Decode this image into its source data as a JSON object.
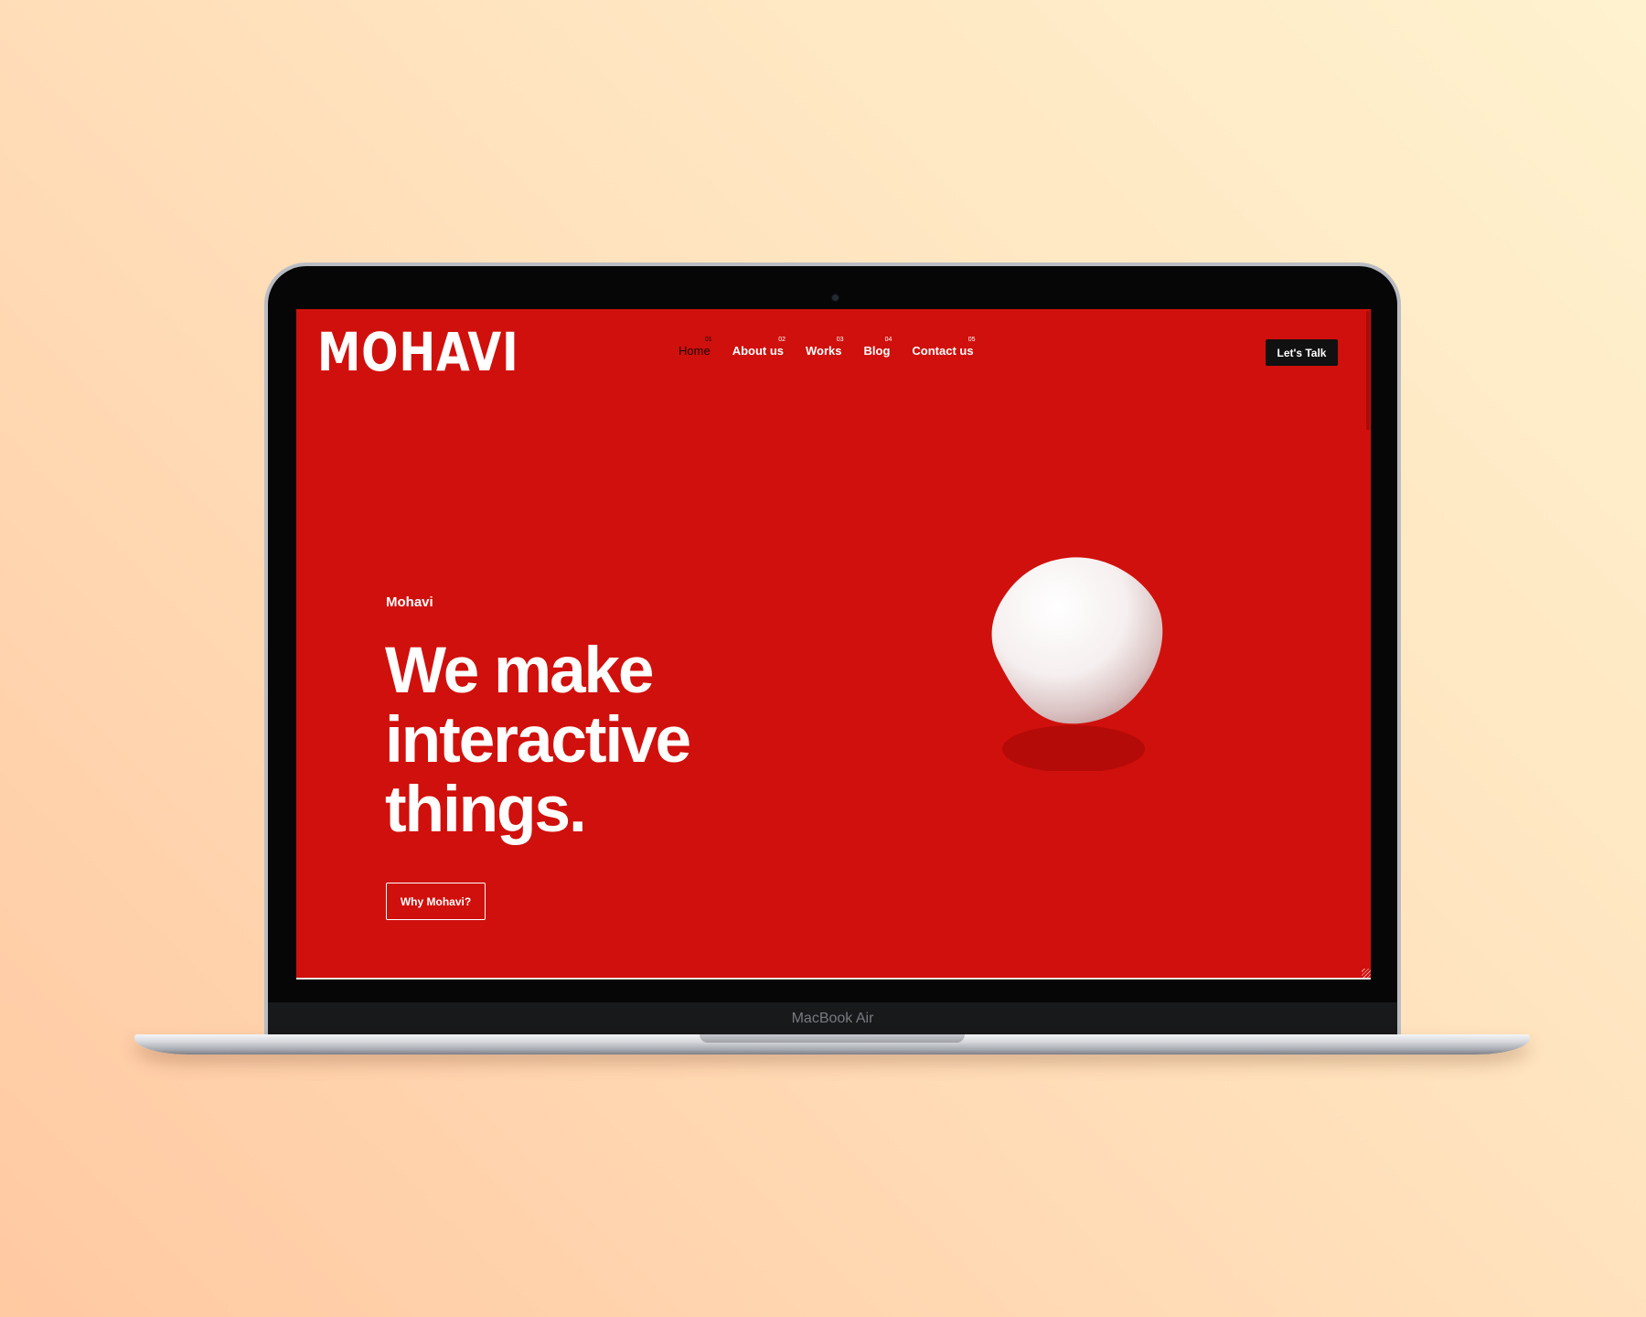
{
  "device": {
    "model_label": "MacBook Air"
  },
  "site": {
    "logo_text": "MOHAVI",
    "nav": [
      {
        "num": "01",
        "label": "Home",
        "active": true
      },
      {
        "num": "02",
        "label": "About us"
      },
      {
        "num": "03",
        "label": "Works"
      },
      {
        "num": "04",
        "label": "Blog"
      },
      {
        "num": "05",
        "label": "Contact us"
      }
    ],
    "cta_top_label": "Let's Talk",
    "hero": {
      "eyebrow": "Mohavi",
      "headline": "We make interactive things.",
      "cta_label": "Why Mohavi?"
    }
  },
  "colors": {
    "background_gradient": [
      "#fff2cf",
      "#ffc9a2"
    ],
    "screen_red": "#d0100c",
    "button_dark": "#111111",
    "text_white": "#ffffff"
  },
  "icons": {
    "hero_graphic": "3d-blob-icon"
  }
}
